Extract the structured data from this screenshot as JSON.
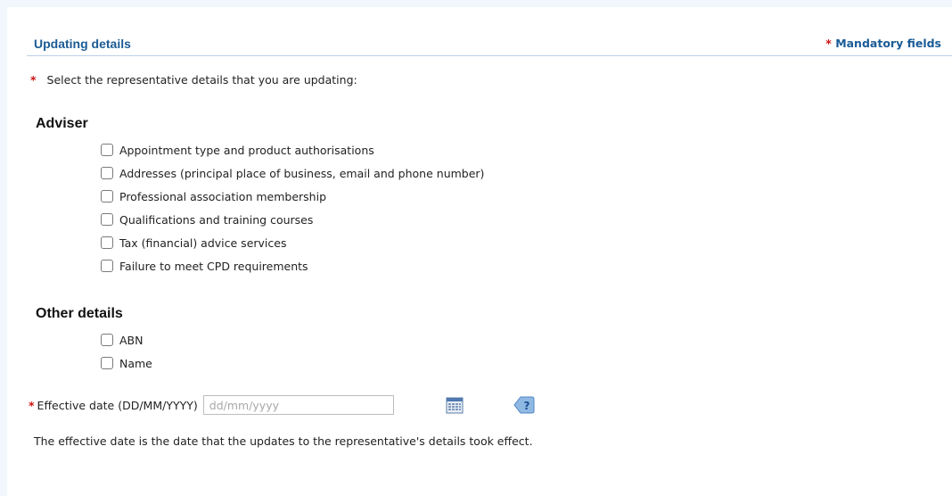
{
  "header": {
    "title": "Updating details",
    "mandatory_star": "*",
    "mandatory_label": "Mandatory fields"
  },
  "instruction": {
    "star": "*",
    "text": "Select the representative details that you are updating:"
  },
  "adviser": {
    "heading": "Adviser",
    "options": [
      {
        "label": "Appointment type and product authorisations",
        "checked": false
      },
      {
        "label": "Addresses (principal place of business, email and phone number)",
        "checked": false
      },
      {
        "label": "Professional association membership",
        "checked": false
      },
      {
        "label": "Qualifications and training courses",
        "checked": false
      },
      {
        "label": "Tax (financial) advice services",
        "checked": false
      },
      {
        "label": "Failure to meet CPD requirements",
        "checked": false
      }
    ]
  },
  "other": {
    "heading": "Other details",
    "options": [
      {
        "label": "ABN",
        "checked": false
      },
      {
        "label": "Name",
        "checked": false
      }
    ]
  },
  "effective_date": {
    "star": "*",
    "label": "Effective date (DD/MM/YYYY)",
    "value": "",
    "placeholder": "dd/mm/yyyy",
    "calendar_icon": "calendar-icon",
    "help_icon": "help-icon"
  },
  "note": "The effective date is the date that the updates to the representative's details took effect.",
  "colors": {
    "heading_blue": "#1b5b96",
    "required_red": "#cc1111",
    "divider": "#b9d0e8"
  }
}
